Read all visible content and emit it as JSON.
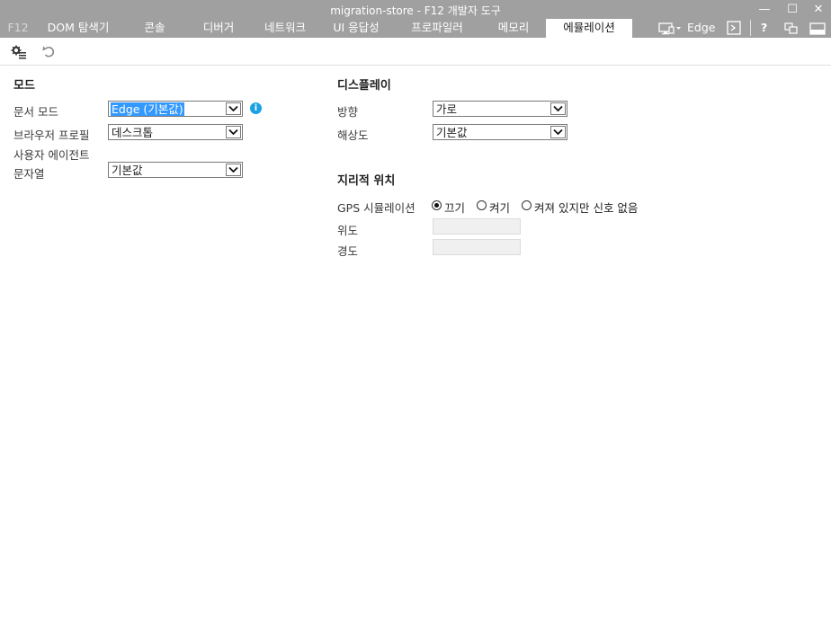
{
  "window": {
    "title": "migration-store - F12 개발자 도구",
    "controls": {
      "minimize": "—",
      "maximize": "☐",
      "close": "✕"
    }
  },
  "tabs": [
    {
      "label": "F12"
    },
    {
      "label": "DOM 탐색기"
    },
    {
      "label": "콘솔"
    },
    {
      "label": "디버거"
    },
    {
      "label": "네트워크"
    },
    {
      "label": "UI 응답성"
    },
    {
      "label": "프로파일러"
    },
    {
      "label": "메모리"
    },
    {
      "label": "에뮬레이션",
      "active": true
    }
  ],
  "right_toolbar": {
    "target_label": "Edge",
    "help": "?"
  },
  "mode": {
    "heading": "모드",
    "document_mode_label": "문서 모드",
    "document_mode_value": "Edge (기본값)",
    "browser_profile_label": "브라우저 프로필",
    "browser_profile_value": "데스크톱",
    "user_agent_label_1": "사용자 에이전트",
    "user_agent_label_2": "문자열",
    "user_agent_value": "기본값",
    "info_icon": "i"
  },
  "display": {
    "heading": "디스플레이",
    "orientation_label": "방향",
    "orientation_value": "가로",
    "resolution_label": "해상도",
    "resolution_value": "기본값"
  },
  "geolocation": {
    "heading": "지리적 위치",
    "gps_label": "GPS 시뮬레이션",
    "options": [
      {
        "label": "끄기",
        "selected": true
      },
      {
        "label": "켜기",
        "selected": false
      },
      {
        "label": "켜져 있지만 신호 없음",
        "selected": false
      }
    ],
    "latitude_label": "위도",
    "latitude_value": "",
    "longitude_label": "경도",
    "longitude_value": ""
  },
  "colors": {
    "titlebar": "#a0a0a0",
    "selection": "#3399ff",
    "info": "#1ba1e2"
  }
}
